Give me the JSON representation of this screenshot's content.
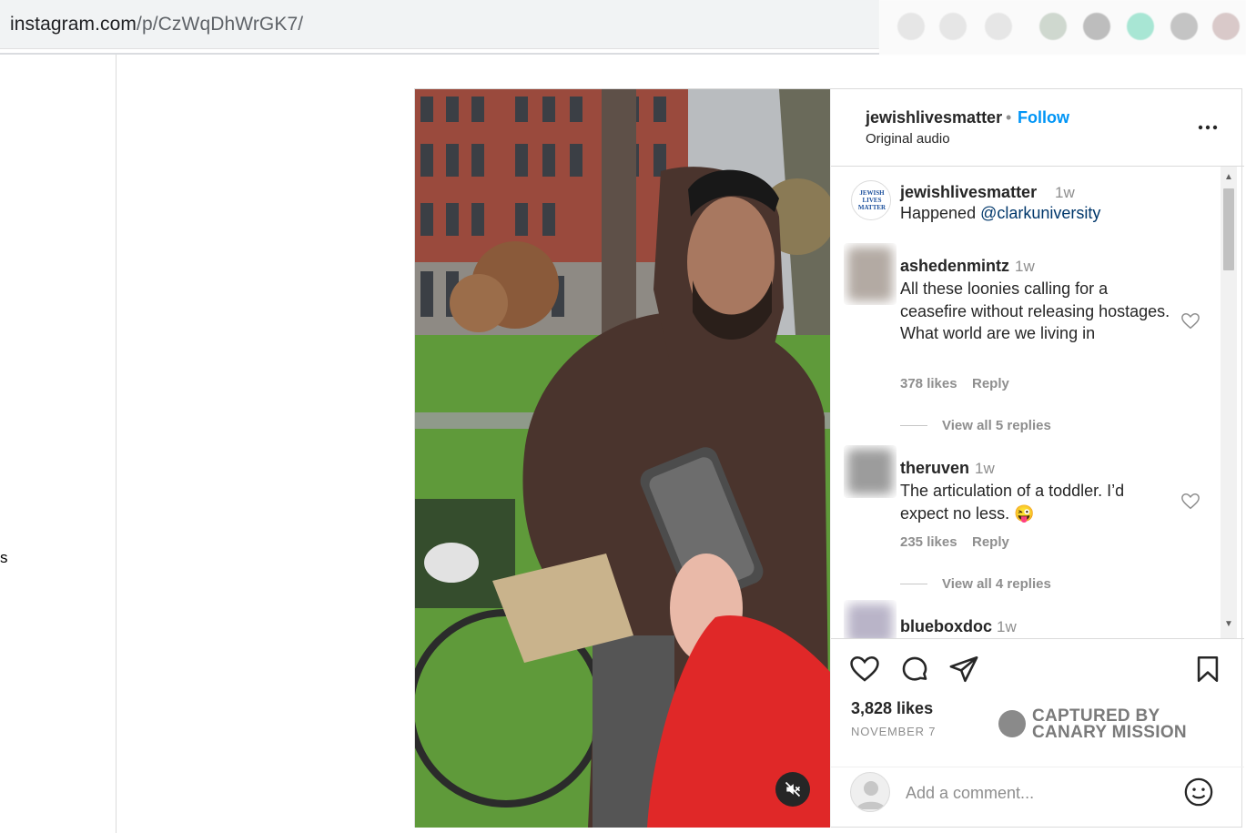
{
  "browser": {
    "url_host": "instagram.com",
    "url_path": "/p/CzWqDhWrGK7/"
  },
  "left_pane": {
    "partial_text": "s"
  },
  "post": {
    "header": {
      "username": "jewishlivesmatter",
      "separator": "•",
      "follow_label": "Follow",
      "audio_label": "Original audio",
      "more_icon": "more-horizontal-icon"
    },
    "caption": {
      "username": "jewishlivesmatter",
      "time": "1w",
      "text": "Happened ",
      "mention": "@clarkuniversity",
      "avatar_text": [
        "JEWISH",
        "LIVES",
        "MATTER"
      ]
    },
    "comments": [
      {
        "username": "ashedenmintz",
        "time": "1w",
        "text": "All these loonies calling for a ceasefire without releasing hostages. What world are we living in",
        "likes": "378 likes",
        "reply_label": "Reply",
        "view_replies": "View all 5 replies"
      },
      {
        "username": "theruven",
        "time": "1w",
        "text": "The articulation of a toddler. I’d expect no less. 😜",
        "likes": "235 likes",
        "reply_label": "Reply",
        "view_replies": "View all 4 replies"
      },
      {
        "username": "blueboxdoc",
        "time": "1w"
      }
    ],
    "likes_count": "3,828 likes",
    "date": "NOVEMBER 7",
    "watermark": [
      "CAPTURED BY",
      "CANARY MISSION"
    ],
    "add_comment_placeholder": "Add a comment...",
    "colors": {
      "follow_blue": "#0095f6",
      "mention_blue": "#00376b",
      "muted": "#8e8e8e",
      "border": "#dbdbdb"
    }
  }
}
